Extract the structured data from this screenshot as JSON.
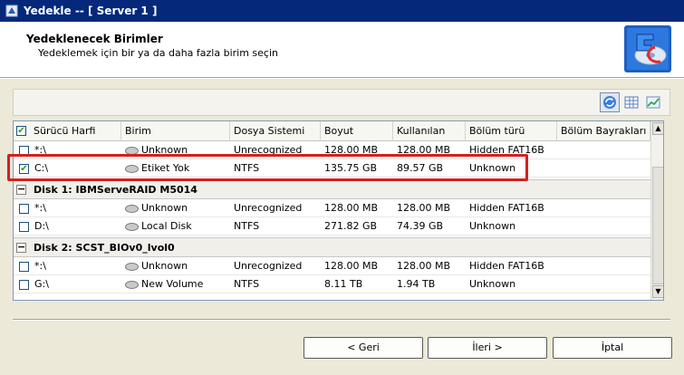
{
  "window": {
    "title": "Yedekle -- [ Server 1 ]"
  },
  "header": {
    "title": "Yedeklenecek Birimler",
    "subtitle": "Yedeklemek için bir ya da daha fazla birim seçin",
    "logo_icon": "backup-logo-icon"
  },
  "toolbar": {
    "icons": [
      "refresh-icon",
      "grid-view-icon",
      "chart-view-icon"
    ]
  },
  "table": {
    "columns": [
      "Sürücü Harfi",
      "Birim",
      "Dosya Sistemi",
      "Boyut",
      "Kullanılan",
      "Bölüm türü",
      "Bölüm Bayrakları"
    ],
    "select_all_checked": true,
    "top_rows": [
      {
        "drive": "*:\\",
        "volume": "Unknown",
        "fs": "Unrecognized",
        "size": "128.00 MB",
        "used": "128.00 MB",
        "type": "Hidden FAT16B",
        "flags": "",
        "checked": false
      },
      {
        "drive": "C:\\",
        "volume": "Etiket Yok",
        "fs": "NTFS",
        "size": "135.75 GB",
        "used": "89.57 GB",
        "type": "Unknown",
        "flags": "",
        "checked": true
      }
    ],
    "groups": [
      {
        "label": "Disk 1: IBMServeRAID M5014",
        "toggle": "−",
        "rows": [
          {
            "drive": "*:\\",
            "volume": "Unknown",
            "fs": "Unrecognized",
            "size": "128.00 MB",
            "used": "128.00 MB",
            "type": "Hidden FAT16B",
            "flags": "",
            "checked": false
          },
          {
            "drive": "D:\\",
            "volume": "Local Disk",
            "fs": "NTFS",
            "size": "271.82 GB",
            "used": "74.39 GB",
            "type": "Unknown",
            "flags": "",
            "checked": false
          }
        ]
      },
      {
        "label": "Disk 2: SCST_BIOv0_lvol0",
        "toggle": "−",
        "rows": [
          {
            "drive": "*:\\",
            "volume": "Unknown",
            "fs": "Unrecognized",
            "size": "128.00 MB",
            "used": "128.00 MB",
            "type": "Hidden FAT16B",
            "flags": "",
            "checked": false
          },
          {
            "drive": "G:\\",
            "volume": "New Volume",
            "fs": "NTFS",
            "size": "8.11 TB",
            "used": "1.94 TB",
            "type": "Unknown",
            "flags": "",
            "checked": false
          }
        ]
      }
    ]
  },
  "buttons": {
    "back": "< Geri",
    "next": "İleri >",
    "cancel": "İptal"
  },
  "colors": {
    "titlebar": "#05287a",
    "highlight": "#d42020",
    "dialog_bg": "#ece9d8"
  }
}
